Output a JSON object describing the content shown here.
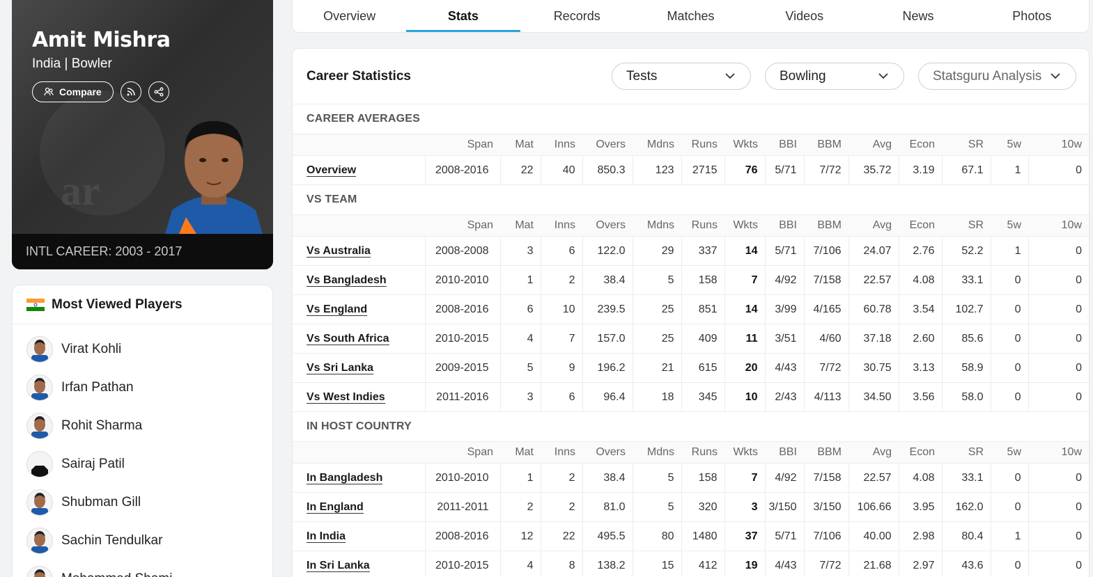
{
  "profile": {
    "name": "Amit Mishra",
    "subtitle": "India | Bowler",
    "compare_label": "Compare",
    "career": "INTL CAREER: 2003 - 2017"
  },
  "most_viewed": {
    "title": "Most Viewed Players",
    "players": [
      "Virat Kohli",
      "Irfan Pathan",
      "Rohit Sharma",
      "Sairaj Patil",
      "Shubman Gill",
      "Sachin Tendulkar",
      "Mohammed Shami"
    ]
  },
  "tabs": [
    "Overview",
    "Stats",
    "Records",
    "Matches",
    "Videos",
    "News",
    "Photos"
  ],
  "active_tab": "Stats",
  "stats": {
    "title": "Career Statistics",
    "format_select": "Tests",
    "type_select": "Bowling",
    "analysis_select": "Statsguru Analysis",
    "columns": [
      "",
      "Span",
      "Mat",
      "Inns",
      "Overs",
      "Mdns",
      "Runs",
      "Wkts",
      "BBI",
      "BBM",
      "Avg",
      "Econ",
      "SR",
      "5w",
      "10w"
    ],
    "sections": [
      {
        "title": "CAREER AVERAGES",
        "rows": [
          [
            "Overview",
            "2008-2016",
            "22",
            "40",
            "850.3",
            "123",
            "2715",
            "76",
            "5/71",
            "7/72",
            "35.72",
            "3.19",
            "67.1",
            "1",
            "0"
          ]
        ]
      },
      {
        "title": "VS TEAM",
        "rows": [
          [
            "Vs Australia",
            "2008-2008",
            "3",
            "6",
            "122.0",
            "29",
            "337",
            "14",
            "5/71",
            "7/106",
            "24.07",
            "2.76",
            "52.2",
            "1",
            "0"
          ],
          [
            "Vs Bangladesh",
            "2010-2010",
            "1",
            "2",
            "38.4",
            "5",
            "158",
            "7",
            "4/92",
            "7/158",
            "22.57",
            "4.08",
            "33.1",
            "0",
            "0"
          ],
          [
            "Vs England",
            "2008-2016",
            "6",
            "10",
            "239.5",
            "25",
            "851",
            "14",
            "3/99",
            "4/165",
            "60.78",
            "3.54",
            "102.7",
            "0",
            "0"
          ],
          [
            "Vs South Africa",
            "2010-2015",
            "4",
            "7",
            "157.0",
            "25",
            "409",
            "11",
            "3/51",
            "4/60",
            "37.18",
            "2.60",
            "85.6",
            "0",
            "0"
          ],
          [
            "Vs Sri Lanka",
            "2009-2015",
            "5",
            "9",
            "196.2",
            "21",
            "615",
            "20",
            "4/43",
            "7/72",
            "30.75",
            "3.13",
            "58.9",
            "0",
            "0"
          ],
          [
            "Vs West Indies",
            "2011-2016",
            "3",
            "6",
            "96.4",
            "18",
            "345",
            "10",
            "2/43",
            "4/113",
            "34.50",
            "3.56",
            "58.0",
            "0",
            "0"
          ]
        ]
      },
      {
        "title": "IN HOST COUNTRY",
        "rows": [
          [
            "In Bangladesh",
            "2010-2010",
            "1",
            "2",
            "38.4",
            "5",
            "158",
            "7",
            "4/92",
            "7/158",
            "22.57",
            "4.08",
            "33.1",
            "0",
            "0"
          ],
          [
            "In England",
            "2011-2011",
            "2",
            "2",
            "81.0",
            "5",
            "320",
            "3",
            "3/150",
            "3/150",
            "106.66",
            "3.95",
            "162.0",
            "0",
            "0"
          ],
          [
            "In India",
            "2008-2016",
            "12",
            "22",
            "495.5",
            "80",
            "1480",
            "37",
            "5/71",
            "7/106",
            "40.00",
            "2.98",
            "80.4",
            "1",
            "0"
          ],
          [
            "In Sri Lanka",
            "2010-2015",
            "4",
            "8",
            "138.2",
            "15",
            "412",
            "19",
            "4/43",
            "7/72",
            "21.68",
            "2.97",
            "43.6",
            "0",
            "0"
          ]
        ]
      }
    ]
  }
}
